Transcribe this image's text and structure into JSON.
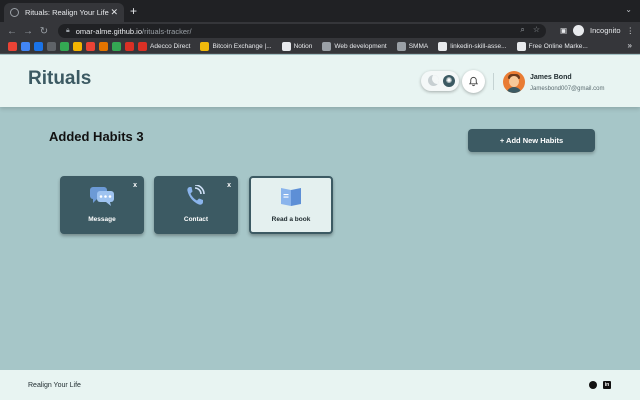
{
  "browser": {
    "tab_title": "Rituals: Realign Your Life",
    "url_host": "omar-alme.github.io",
    "url_path": "/rituals-tracker/",
    "profile_label": "Incognito",
    "bookmarks": [
      {
        "label": "",
        "color": "#ea4335"
      },
      {
        "label": "",
        "color": "#4285f4"
      },
      {
        "label": "",
        "color": "#1a73e8"
      },
      {
        "label": "",
        "color": "#5f6368"
      },
      {
        "label": "",
        "color": "#34a853"
      },
      {
        "label": "",
        "color": "#f4b400"
      },
      {
        "label": "",
        "color": "#ea4335"
      },
      {
        "label": "",
        "color": "#e37400"
      },
      {
        "label": "",
        "color": "#34a853"
      },
      {
        "label": "",
        "color": "#d93025"
      },
      {
        "label": "Adecco Direct",
        "color": "#d93025"
      },
      {
        "label": "Bitcoin Exchange |...",
        "color": "#f0b90b"
      },
      {
        "label": "Notion",
        "color": "#e8eaed"
      },
      {
        "label": "Web development",
        "color": "#9aa0a6"
      },
      {
        "label": "SMMA",
        "color": "#9aa0a6"
      },
      {
        "label": "linkedin-skill-asse...",
        "color": "#e8eaed"
      },
      {
        "label": "Free Online Marke...",
        "color": "#e8eaed"
      }
    ]
  },
  "header": {
    "logo": "Rituals",
    "user_name": "James Bond",
    "user_email": "Jamesbond007@gmail.com"
  },
  "main": {
    "title": "Added Habits 3",
    "add_button": "+ Add New Habits",
    "habits": [
      {
        "label": "Message",
        "close": "x"
      },
      {
        "label": "Contact",
        "close": "x"
      },
      {
        "label": "Read a book"
      }
    ]
  },
  "footer": {
    "text": "Realign Your Life"
  },
  "colors": {
    "accent": "#3c5a63",
    "background": "#a6c6c8",
    "surface": "#e8f4f2"
  }
}
